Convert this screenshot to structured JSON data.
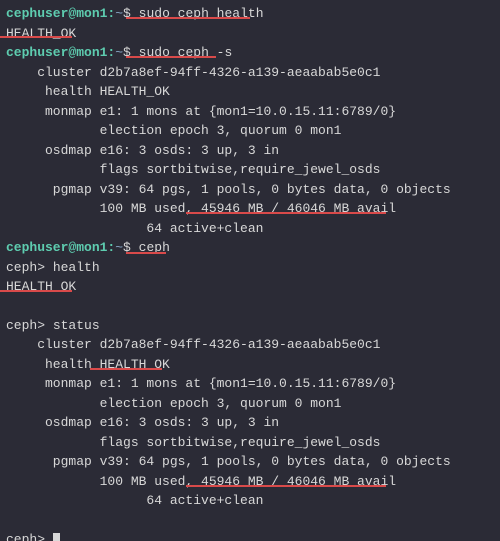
{
  "prompt": {
    "userhost": "cephuser@mon1",
    "sep": ":",
    "path": "~",
    "dollar": "$"
  },
  "cmd1": "sudo ceph health",
  "cmd1_out": "HEALTH_OK",
  "cmd2": "sudo ceph -s",
  "status1": {
    "cluster": "    cluster d2b7a8ef-94ff-4326-a139-aeaabab5e0c1",
    "health": "     health HEALTH_OK",
    "monmap": "     monmap e1: 1 mons at {mon1=10.0.15.11:6789/0}",
    "election": "            election epoch 3, quorum 0 mon1",
    "osdmap": "     osdmap e16: 3 osds: 3 up, 3 in",
    "flags": "            flags sortbitwise,require_jewel_osds",
    "pgmap": "      pgmap v39: 64 pgs, 1 pools, 0 bytes data, 0 objects",
    "used": "            100 MB used, 45946 MB / 46046 MB avail",
    "active": "                  64 active+clean"
  },
  "cmd3": "ceph",
  "ceph_prompt": "ceph>",
  "sub1": "health",
  "sub1_out": "HEALTH_OK",
  "sub2": "status",
  "status2": {
    "cluster": "    cluster d2b7a8ef-94ff-4326-a139-aeaabab5e0c1",
    "health": "     health HEALTH_OK",
    "monmap": "     monmap e1: 1 mons at {mon1=10.0.15.11:6789/0}",
    "election": "            election epoch 3, quorum 0 mon1",
    "osdmap": "     osdmap e16: 3 osds: 3 up, 3 in",
    "flags": "            flags sortbitwise,require_jewel_osds",
    "pgmap": "      pgmap v39: 64 pgs, 1 pools, 0 bytes data, 0 objects",
    "used": "            100 MB used, 45946 MB / 46046 MB avail",
    "active": "                  64 active+clean"
  }
}
